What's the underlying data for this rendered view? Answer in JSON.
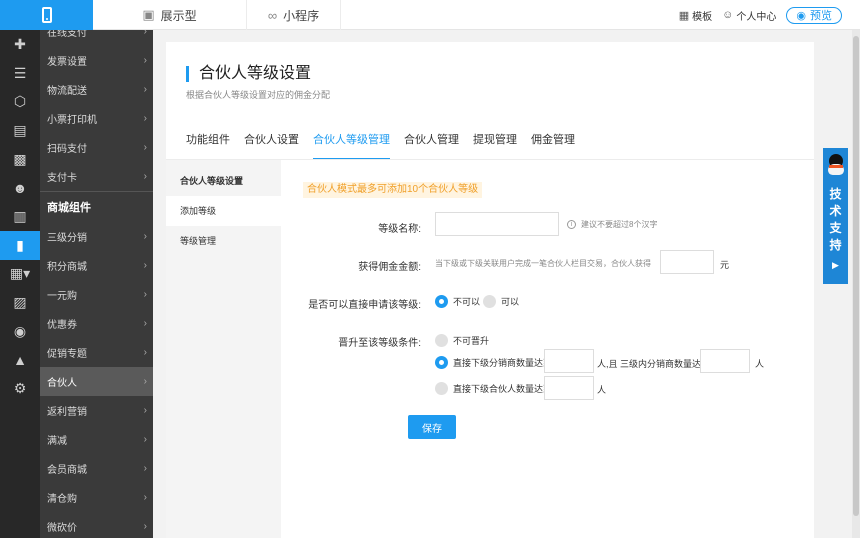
{
  "topbar": {
    "tabs": [
      {
        "label": "展示型",
        "icon": "monitor-icon"
      },
      {
        "label": "小程序",
        "icon": "mini-program-icon"
      }
    ],
    "tools": {
      "template_label": "模板",
      "user_center_label": "个人中心",
      "preview_label": "预览"
    }
  },
  "sidebar": {
    "items_before": [
      {
        "label": "在线支付"
      },
      {
        "label": "发票设置"
      },
      {
        "label": "物流配送"
      },
      {
        "label": "小票打印机"
      },
      {
        "label": "扫码支付"
      },
      {
        "label": "支付卡"
      }
    ],
    "group_label": "商城组件",
    "items_after": [
      {
        "label": "三级分销",
        "active": false
      },
      {
        "label": "积分商城",
        "active": false
      },
      {
        "label": "一元购",
        "active": false
      },
      {
        "label": "优惠券",
        "active": false
      },
      {
        "label": "促销专题",
        "active": false
      },
      {
        "label": "合伙人",
        "active": true
      },
      {
        "label": "返利营销",
        "active": false
      },
      {
        "label": "满减",
        "active": false
      },
      {
        "label": "会员商城",
        "active": false
      },
      {
        "label": "清仓购",
        "active": false
      },
      {
        "label": "微砍价",
        "active": false
      }
    ]
  },
  "panel": {
    "title": "合伙人等级设置",
    "subtitle": "根据合伙人等级设置对应的佣金分配",
    "tabs": [
      {
        "label": "功能组件",
        "active": false
      },
      {
        "label": "合伙人设置",
        "active": false
      },
      {
        "label": "合伙人等级管理",
        "active": true
      },
      {
        "label": "合伙人管理",
        "active": false
      },
      {
        "label": "提现管理",
        "active": false
      },
      {
        "label": "佣金管理",
        "active": false
      }
    ],
    "left_menu": {
      "header": "合伙人等级设置",
      "items": [
        {
          "label": "添加等级",
          "active": true
        },
        {
          "label": "等级管理",
          "active": false
        }
      ]
    },
    "form": {
      "notice": "合伙人模式最多可添加10个合伙人等级",
      "level_name": {
        "label": "等级名称:",
        "value": "",
        "hint": "建议不要超过8个汉字"
      },
      "commission": {
        "label": "获得佣金金额:",
        "desc": "当下级或下级关联用户完成一笔合伙人栏目交易，合伙人获得",
        "value": "",
        "unit": "元"
      },
      "direct_apply": {
        "label": "是否可以直接申请该等级:",
        "options": [
          {
            "label": "不可以",
            "selected": true
          },
          {
            "label": "可以",
            "selected": false
          }
        ]
      },
      "upgrade": {
        "label": "晋升至该等级条件:",
        "opt_none": "不可晋升",
        "opt_distributor_pre": "直接下级分销商数量达到",
        "opt_distributor_mid": "人,且 三级内分销商数量达到",
        "opt_distributor_unit": "人",
        "opt_partner_pre": "直接下级合伙人数量达到",
        "opt_partner_unit": "人",
        "selected": "distributor"
      },
      "save_label": "保存"
    }
  },
  "support": {
    "label_chars": [
      "技",
      "术",
      "支",
      "持"
    ]
  }
}
